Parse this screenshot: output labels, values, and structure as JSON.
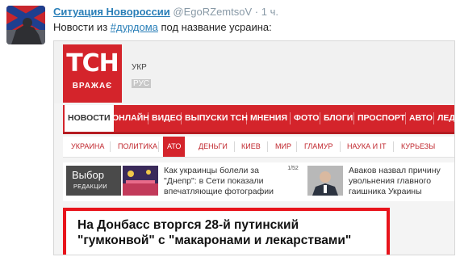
{
  "tweet": {
    "author_name": "Ситуация Новороссии",
    "handle": "@EgoRZemtsoV",
    "time": "· 1 ч.",
    "text_before": "Новости из ",
    "hashtag": "#дурдома",
    "text_after": " под название усраина:"
  },
  "site": {
    "logo": "ТСН",
    "logo_sub": "ВРАЖАЄ",
    "lang_ua": "УКР",
    "lang_ru": "РУС",
    "nav": [
      "НОВОСТИ",
      "ОНЛАЙН",
      "ВИДЕО",
      "ВЫПУСКИ ТСН",
      "МНЕНИЯ",
      "ФОТО",
      "БЛОГИ",
      "ПРОСПОРТ",
      "АВТО",
      "ЛЕДИ"
    ],
    "subnav": [
      "УКРАИНА",
      "ПОЛИТИКА",
      "АТО",
      "ДЕНЬГИ",
      "КИЕВ",
      "МИР",
      "ГЛАМУР",
      "НАУКА И IT",
      "КУРЬЕЗЫ"
    ],
    "choice_title": "Выбор",
    "choice_sub": "РЕДАКЦИИ",
    "news1": "Как украинцы болели за \"Днепр\": в Сети показали впечатляющие фотографии",
    "gallery_count": "1/52",
    "news2": "Аваков назвал причину увольнения главного гаишника Украины",
    "headline_line1": "На Донбасс вторгся 28-й путинский",
    "headline_line2": "\"гумконвой\" с \"макаронами и лекарствами\""
  },
  "colors": {
    "tsn_red": "#d4242b",
    "twitter_link": "#2a7fb8",
    "highlight_border": "#e8141c"
  }
}
